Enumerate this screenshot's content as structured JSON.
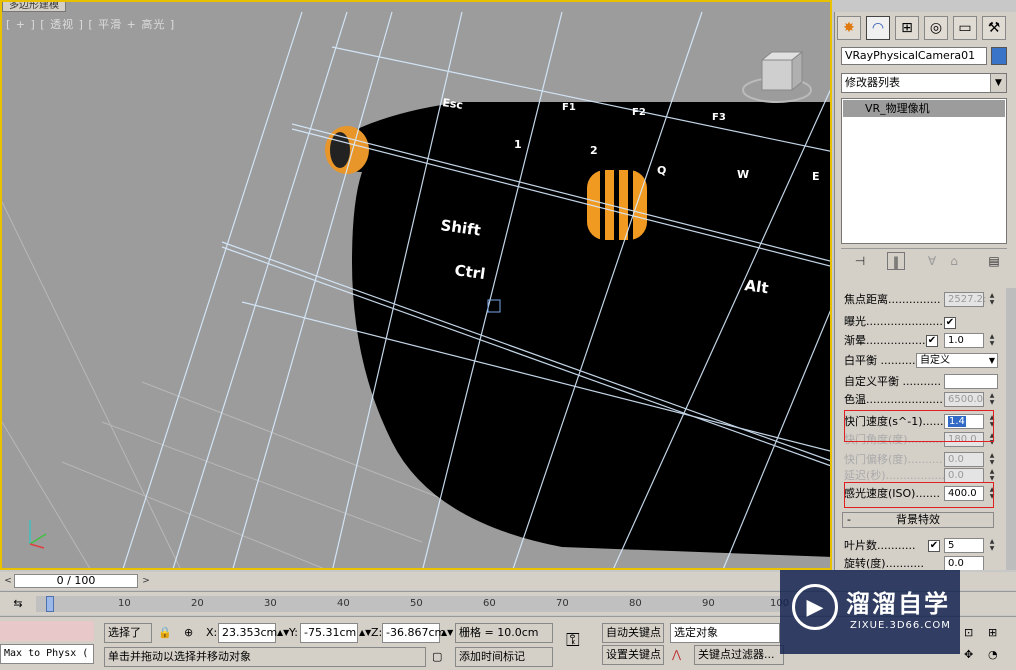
{
  "viewport": {
    "title_tab": "多边形建模",
    "label": "[ + ] [ 透视 ] [ 平滑 + 高光 ]",
    "keyboard_labels": {
      "esc": "Esc",
      "f1": "F1",
      "f2": "F2",
      "f3": "F3",
      "one": "1",
      "two": "2",
      "shift": "Shift",
      "ctrl": "Ctrl",
      "alt": "Alt",
      "q": "Q",
      "w": "W",
      "e": "E"
    }
  },
  "command_panel": {
    "tabs": [
      "create-icon",
      "modify-icon",
      "hierarchy-icon",
      "motion-icon",
      "display-icon",
      "utilities-icon"
    ],
    "object_name": "VRayPhysicalCamera01",
    "object_color": "#3a74c8",
    "modifier_list": "修改器列表",
    "stack_item": "VR_物理像机"
  },
  "params": {
    "focus_distance_label": "焦点距离...............",
    "focus_distance_value": "2527.2:",
    "exposure_label": "曝光.......................",
    "exposure_checked": "✔",
    "vignetting_label": "渐晕.................",
    "vignetting_checked": "✔",
    "vignetting_value": "1.0",
    "white_balance_label": "白平衡 ..........",
    "white_balance_value": "自定义",
    "custom_balance_label": "自定义平衡 ...........",
    "temperature_label": "色温......................",
    "temperature_value": "6500.0",
    "shutter_speed_label": "快门速度(s^-1)......",
    "shutter_speed_value": "1.4",
    "shutter_angle_label": "快门角度(度)..........",
    "shutter_angle_value": "180.0",
    "shutter_offset_label": "快门偏移(度)..........",
    "shutter_offset_value": "0.0",
    "latency_label": "延迟(秒)...................",
    "latency_value": "0.0",
    "iso_label": "感光速度(ISO).......",
    "iso_value": "400.0",
    "bg_effect_section": "背景特效",
    "bg_effect_minus": "-",
    "blades_label": "叶片数...........",
    "blades_checked": "✔",
    "blades_value": "5",
    "rotation_label": "旋转(度)...........",
    "rotation_value": "0.0"
  },
  "timeline": {
    "slider_text": "0 / 100",
    "ticks": [
      "0",
      "10",
      "20",
      "30",
      "40",
      "50",
      "60",
      "70",
      "80",
      "90",
      "100"
    ]
  },
  "status": {
    "max_to_physx": "Max to Physx (",
    "selected": "选择了",
    "x_label": "X:",
    "x_value": "23.353cm",
    "y_label": "Y:",
    "y_value": "-75.31cm",
    "z_label": "Z:",
    "z_value": "-36.867cm",
    "grid": "栅格 = 10.0cm",
    "auto_key": "自动关键点",
    "set_key": "设置关键点",
    "selected_obj": "选定对象",
    "key_filter": "关键点过滤器...",
    "prompt": "单击并拖动以选择并移动对象",
    "add_time_tag": "添加时间标记"
  },
  "watermark": {
    "title": "溜溜自学",
    "url": "ZIXUE.3D66.COM"
  }
}
